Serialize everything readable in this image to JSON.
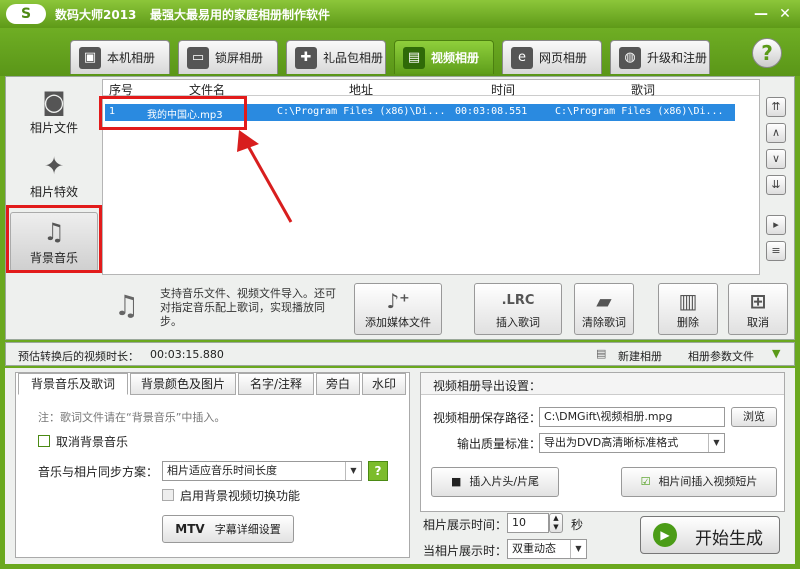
{
  "window": {
    "app_title": "数码大师2013",
    "subtitle": "最强大最易用的家庭相册制作软件",
    "logo": "S",
    "minimize": "—",
    "close": "✕"
  },
  "main_tabs": [
    {
      "label": "本机相册",
      "icon": "photo-frame-icon"
    },
    {
      "label": "锁屏相册",
      "icon": "monitor-icon"
    },
    {
      "label": "礼品包相册",
      "icon": "gift-icon"
    },
    {
      "label": "视频相册",
      "icon": "film-icon"
    },
    {
      "label": "网页相册",
      "icon": "ie-icon"
    },
    {
      "label": "升级和注册",
      "icon": "globe-icon"
    }
  ],
  "help": "?",
  "sidebar": [
    {
      "label": "相片文件",
      "icon": "camera-icon"
    },
    {
      "label": "相片特效",
      "icon": "sparkle-icon"
    },
    {
      "label": "背景音乐",
      "icon": "music-note-icon"
    }
  ],
  "list": {
    "headers": {
      "index": "序号",
      "file": "文件名",
      "path": "地址",
      "time": "时间",
      "lyric": "歌词"
    },
    "rows": [
      {
        "index": "1",
        "file": "我的中国心.mp3",
        "path": "C:\\Program Files (x86)\\Di...",
        "time": "00:03:08.551",
        "lyric": "C:\\Program Files (x86)\\Di..."
      }
    ]
  },
  "hint": "支持音乐文件、视频文件导入。还可对指定音乐配上歌词，实现播放同步。",
  "tools": {
    "add_media": "添加媒体文件",
    "insert_lyric": "插入歌词",
    "lrc": ".LRC",
    "clear_lyric": "清除歌词",
    "delete": "删除",
    "cancel": "取消"
  },
  "status": {
    "duration_label": "预估转换后的视频时长：",
    "duration": "00:03:15.880",
    "new_album": "新建相册",
    "album_params": "相册参数文件"
  },
  "sub_tabs": [
    "背景音乐及歌词",
    "背景颜色及图片",
    "名字/注释",
    "旁白",
    "水印"
  ],
  "music_panel": {
    "note": "注：歌词文件请在“背景音乐”中插入。",
    "cancel_bg_music": "取消背景音乐",
    "sync_label": "音乐与相片同步方案：",
    "sync_value": "相片适应音乐时间长度",
    "enable_bg_video": "启用背景视频切换功能",
    "mtv": "MTV",
    "subtitle_settings": "字幕详细设置"
  },
  "export": {
    "title": "视频相册导出设置：",
    "save_label": "视频相册保存路径：",
    "save_path": "C:\\DMGift\\视频相册.mpg",
    "browse": "浏览",
    "quality_label": "输出质量标准：",
    "quality_value": "导出为DVD高清晰标准格式",
    "insert_head": "插入片头/片尾",
    "insert_clip": "相片间插入视频短片"
  },
  "display": {
    "time_label": "相片展示时间：",
    "time_value": "10",
    "unit": "秒",
    "mode_label": "当相片展示时：",
    "mode_value": "双重动态"
  },
  "start": "开始生成"
}
